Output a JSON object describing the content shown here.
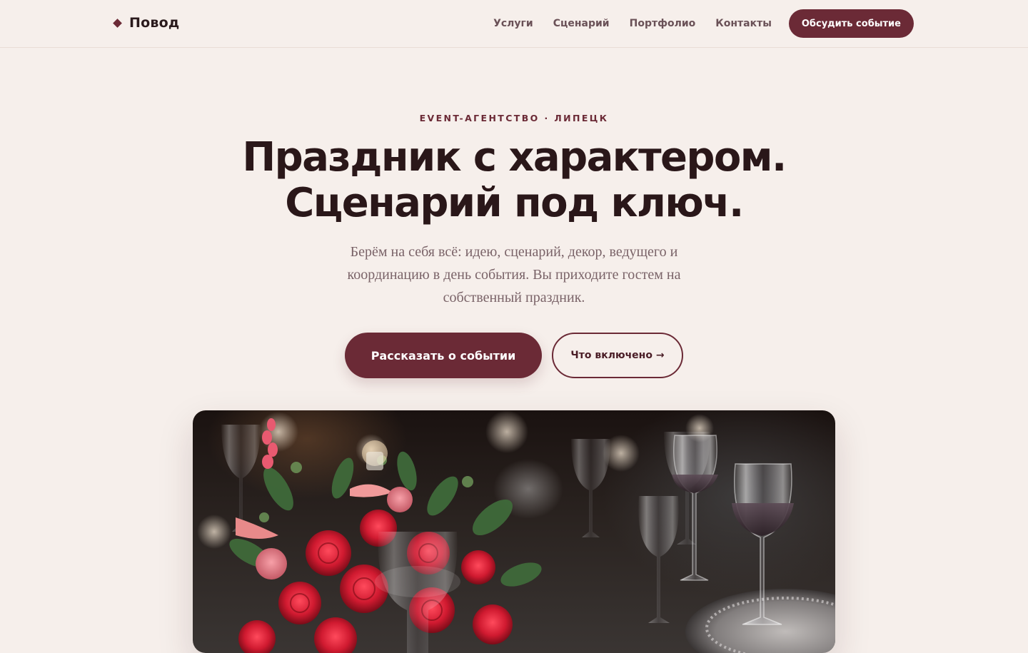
{
  "header": {
    "logo": "Повод",
    "nav": [
      "Услуги",
      "Сценарий",
      "Портфолио",
      "Контакты"
    ],
    "cta": "Обсудить событие"
  },
  "hero": {
    "eyebrow": "EVENT-АГЕНТСТВО · ЛИПЕЦК",
    "headline_line1": "Праздник с характером.",
    "headline_line2": "Сценарий под ключ.",
    "lead": "Берём на себя всё: идею, сценарий, декор, ведущего и координацию в день события. Вы приходите гостем на собственный праздник.",
    "primary_button": "Рассказать о событии",
    "secondary_button": "Что включено →"
  },
  "colors": {
    "accent": "#6b2a36",
    "background": "#f6efeb",
    "heading": "#2a1719",
    "muted": "#7a6368"
  }
}
